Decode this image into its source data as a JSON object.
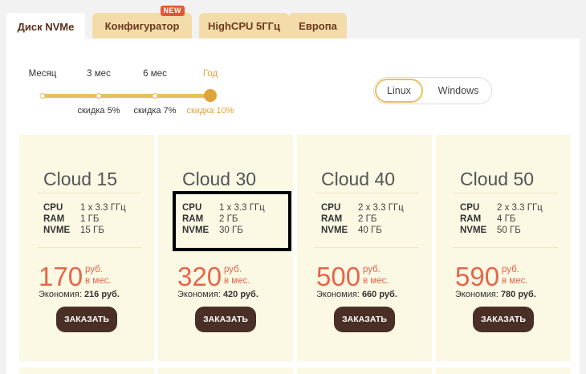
{
  "tabs": [
    {
      "label": "Диск NVMe",
      "active": true
    },
    {
      "label": "Конфигуратор",
      "badge": "NEW"
    },
    {
      "label": "HighCPU 5ГГц"
    },
    {
      "label": "Европа"
    }
  ],
  "period": {
    "labels": [
      "Месяц",
      "3 мес",
      "6 мес",
      "Год"
    ],
    "discounts": [
      "скидка 5%",
      "скидка 7%",
      "скидка 10%"
    ],
    "selected": "Год"
  },
  "os": {
    "options": [
      "Linux",
      "Windows"
    ],
    "selected": "Linux"
  },
  "colors": {
    "accent": "#e0a33a",
    "price": "#e5664a",
    "button": "#4a2f27",
    "card": "#fbf8e4",
    "tab": "#f3dca9"
  },
  "plans": [
    {
      "name": "Cloud 15",
      "specs": [
        {
          "k": "CPU",
          "v": "1 x 3.3 ГГц"
        },
        {
          "k": "RAM",
          "v": "1 ГБ"
        },
        {
          "k": "NVME",
          "v": "15 ГБ"
        }
      ],
      "price": "170",
      "currency": "руб.",
      "per": "в мес.",
      "saving_label": "Экономия:",
      "saving": "216 руб.",
      "order": "ЗАКАЗАТЬ"
    },
    {
      "name": "Cloud 30",
      "specs": [
        {
          "k": "CPU",
          "v": "1 x 3.3 ГГц"
        },
        {
          "k": "RAM",
          "v": "2 ГБ"
        },
        {
          "k": "NVME",
          "v": "30 ГБ"
        }
      ],
      "price": "320",
      "currency": "руб.",
      "per": "в мес.",
      "saving_label": "Экономия:",
      "saving": "420 руб.",
      "order": "ЗАКАЗАТЬ"
    },
    {
      "name": "Cloud 40",
      "specs": [
        {
          "k": "CPU",
          "v": "2 x 3.3 ГГц"
        },
        {
          "k": "RAM",
          "v": "2 ГБ"
        },
        {
          "k": "NVME",
          "v": "40 ГБ"
        }
      ],
      "price": "500",
      "currency": "руб.",
      "per": "в мес.",
      "saving_label": "Экономия:",
      "saving": "660 руб.",
      "order": "ЗАКАЗАТЬ"
    },
    {
      "name": "Cloud 50",
      "specs": [
        {
          "k": "CPU",
          "v": "2 x 3.3 ГГц"
        },
        {
          "k": "RAM",
          "v": "4 ГБ"
        },
        {
          "k": "NVME",
          "v": "50 ГБ"
        }
      ],
      "price": "590",
      "currency": "руб.",
      "per": "в мес.",
      "saving_label": "Экономия:",
      "saving": "780 руб.",
      "order": "ЗАКАЗАТЬ"
    }
  ]
}
